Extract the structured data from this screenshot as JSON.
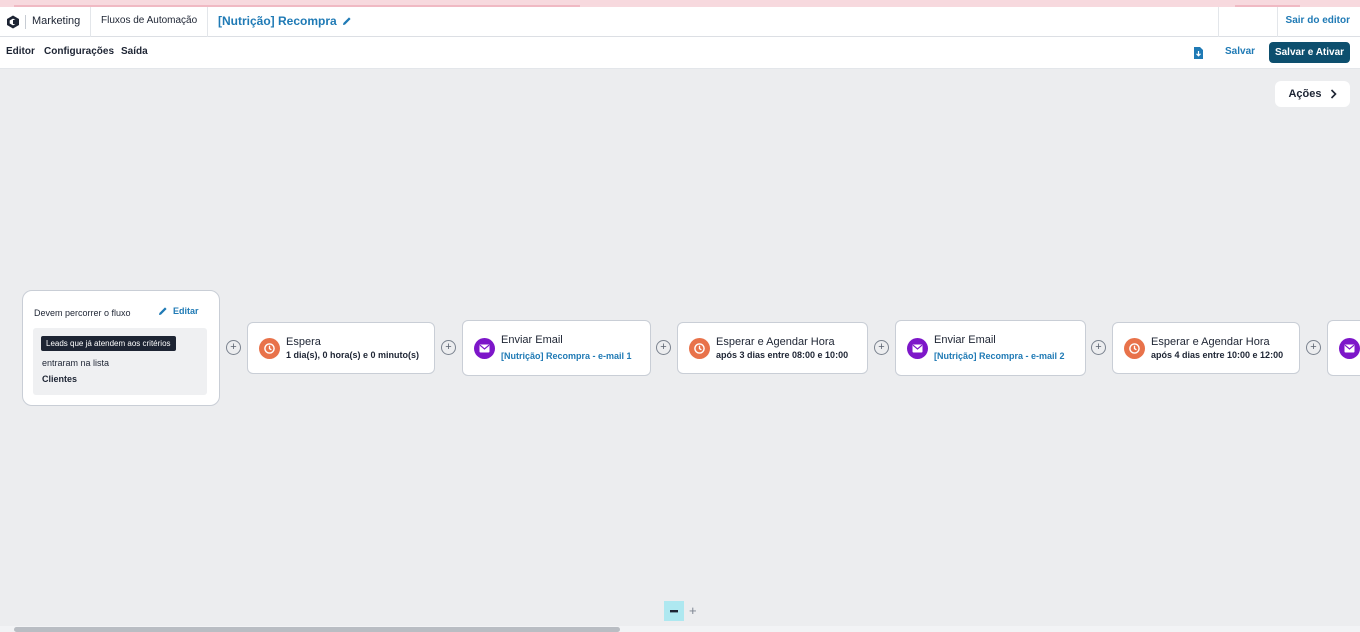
{
  "topbar": {
    "brand": "Marketing",
    "breadcrumb": "Fluxos de Automação",
    "flow_title": "[Nutrição] Recompra",
    "exit_label": "Sair do editor"
  },
  "menubar": {
    "items": [
      "Editor",
      "Configurações",
      "Saída"
    ],
    "save_label": "Salvar",
    "save_activate_label": "Salvar e Ativar"
  },
  "canvas": {
    "actions_label": "Ações",
    "start": {
      "title": "Devem percorrer o fluxo",
      "edit_label": "Editar",
      "tag": "Leads que já atendem aos critérios",
      "line": "entraram na lista",
      "list_name": "Clientes"
    },
    "nodes": [
      {
        "type": "wait",
        "title": "Espera",
        "subtitle": "1 dia(s), 0 hora(s) e 0 minuto(s)"
      },
      {
        "type": "email",
        "title": "Enviar Email",
        "subtitle": "[Nutrição] Recompra - e-mail 1"
      },
      {
        "type": "wait",
        "title": "Esperar e Agendar Hora",
        "subtitle": "após 3 dias entre 08:00 e 10:00"
      },
      {
        "type": "email",
        "title": "Enviar Email",
        "subtitle": "[Nutrição] Recompra - e-mail 2"
      },
      {
        "type": "wait",
        "title": "Esperar e Agendar Hora",
        "subtitle": "após 4 dias entre 10:00 e 12:00"
      }
    ],
    "zoom_in": "+"
  },
  "colors": {
    "accent": "#1f7ab5",
    "primary_button": "#0d4f6e",
    "wait_icon": "#e8724a",
    "email_icon": "#7d16c9"
  }
}
